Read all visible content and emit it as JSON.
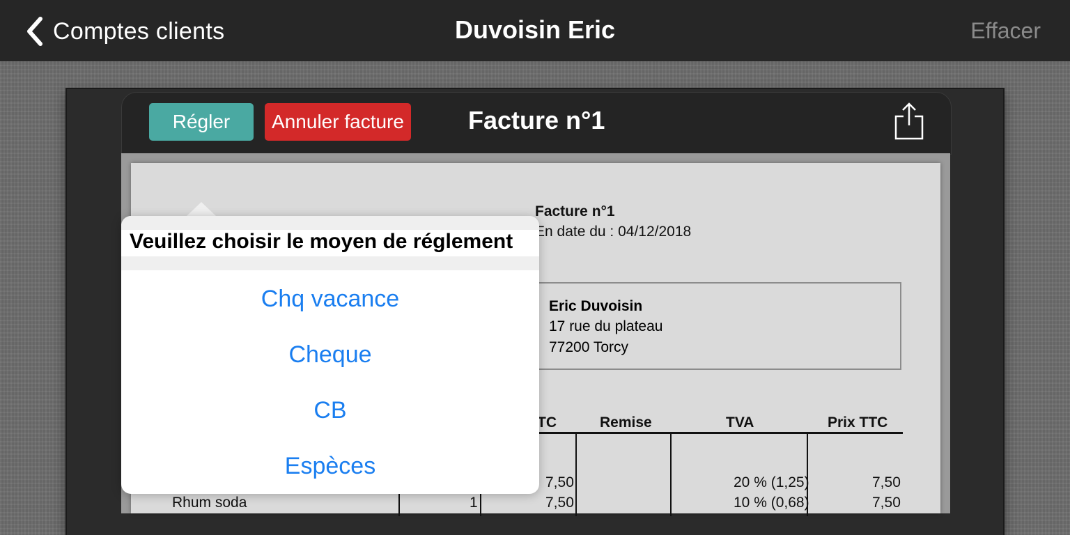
{
  "navbar": {
    "back_label": "Comptes clients",
    "title": "Duvoisin Eric",
    "right_action": "Effacer"
  },
  "toolbar": {
    "regler_label": "Régler",
    "annuler_label": "Annuler facture",
    "title": "Facture n°1",
    "share_icon": "share-icon"
  },
  "invoice": {
    "title": "Facture n°1",
    "date": "En date du : 04/12/2018",
    "client": {
      "name": "Eric Duvoisin",
      "address_line1": "17 rue du plateau",
      "address_line2": "77200 Torcy"
    },
    "columns": [
      "TC",
      "Remise",
      "TVA",
      "Prix TTC"
    ],
    "rows": [
      {
        "article": "",
        "qty": "",
        "pu": "7,50",
        "remise": "",
        "tva": "20 % (1,25)",
        "prix_ttc": "7,50"
      },
      {
        "article": "Rhum soda",
        "qty": "1",
        "pu": "7,50",
        "remise": "",
        "tva": "10 % (0,68)",
        "prix_ttc": "7,50"
      }
    ]
  },
  "popover": {
    "title": "Veuillez choisir le moyen de réglement",
    "options": [
      "Chq vacance",
      "Cheque",
      "CB",
      "Espèces"
    ]
  },
  "colors": {
    "navbar_bg": "#262626",
    "regler_button": "#4aa9a2",
    "annuler_button": "#d32929",
    "option_text": "#1a7ef0",
    "paper": "#dadada"
  }
}
